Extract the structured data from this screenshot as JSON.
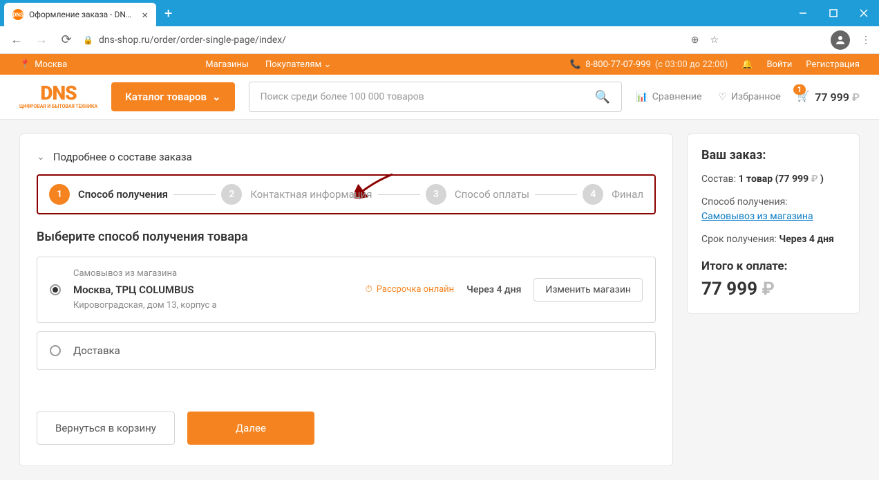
{
  "browser": {
    "tab_title": "Оформление заказа - DNS – ин",
    "url": "dns-shop.ru/order/order-single-page/index/"
  },
  "topbar": {
    "city": "Москва",
    "links": {
      "stores": "Магазины",
      "customers": "Покупателям"
    },
    "phone": "8-800-77-07-999",
    "hours": "(с 03:00 до 22:00)",
    "login": "Войти",
    "register": "Регистрация"
  },
  "header": {
    "logo_main": "DNS",
    "logo_sub": "ЦИФРОВАЯ И\nБЫТОВАЯ ТЕХНИКА",
    "catalog": "Каталог товаров",
    "search_placeholder": "Поиск среди более 100 000 товаров",
    "compare": "Сравнение",
    "favorites": "Избранное",
    "cart_badge": "1",
    "cart_price": "77 999"
  },
  "checkout": {
    "details_label": "Подробнее о составе заказа",
    "steps": [
      {
        "num": "1",
        "label": "Способ получения"
      },
      {
        "num": "2",
        "label": "Контактная информация"
      },
      {
        "num": "3",
        "label": "Способ оплаты"
      },
      {
        "num": "4",
        "label": "Финал"
      }
    ],
    "choose_title": "Выберите способ получения товара",
    "pickup": {
      "sub": "Самовывоз из магазина",
      "main": "Москва, ТРЦ COLUMBUS",
      "addr": "Кировоградская, дом 13, корпус а",
      "installment": "Рассрочка онлайн",
      "eta": "Через 4 дня",
      "change": "Изменить магазин"
    },
    "delivery": "Доставка",
    "back": "Вернуться в корзину",
    "next": "Далее"
  },
  "summary": {
    "title": "Ваш заказ:",
    "contents_label": "Состав:",
    "contents_value": "1 товар (77 999",
    "method_label": "Способ получения:",
    "method_value": "Самовывоз из магазина",
    "eta_label": "Срок получения:",
    "eta_value": "Через 4 дня",
    "total_label": "Итого к оплате:",
    "total_price": "77 999"
  }
}
